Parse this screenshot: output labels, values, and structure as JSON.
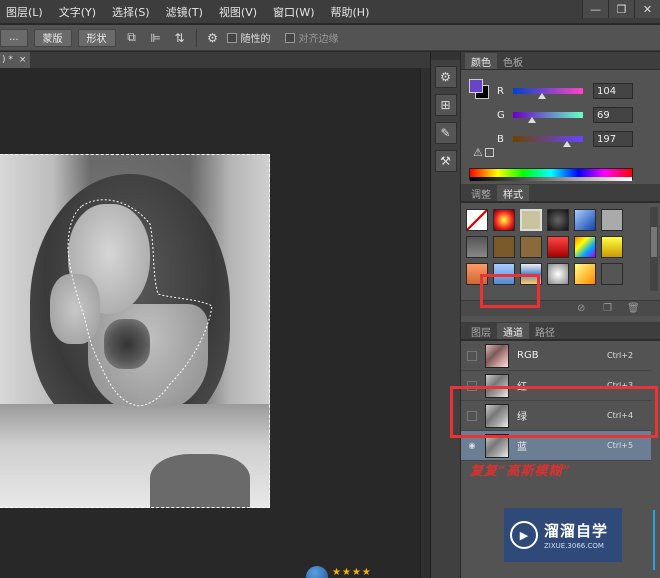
{
  "menu": [
    "图层(L)",
    "文字(Y)",
    "选择(S)",
    "滤镜(T)",
    "视图(V)",
    "窗口(W)",
    "帮助(H)"
  ],
  "window_controls": [
    "—",
    "❐",
    "✕"
  ],
  "options_bar": {
    "ellipsis": "...",
    "mask_label": "蒙版",
    "shape_label": "形状",
    "reset_checkbox_label": "随性的",
    "align_edges_label": "对齐边缘"
  },
  "doc_tab": {
    "label": ") *",
    "close": "×"
  },
  "color_panel": {
    "tabs": [
      "颜色",
      "色板"
    ],
    "r_label": "R",
    "g_label": "G",
    "b_label": "B",
    "r": "104",
    "g": "69",
    "b": "197",
    "fg_color": "#6845c5",
    "bg_color": "#000000"
  },
  "styles_panel": {
    "tabs": [
      "调整",
      "样式"
    ]
  },
  "channels_panel": {
    "tabs": [
      "图层",
      "通道",
      "路径"
    ],
    "channels": [
      {
        "name": "RGB",
        "shortcut": "Ctrl+2"
      },
      {
        "name": "红",
        "shortcut": "Ctrl+3"
      },
      {
        "name": "绿",
        "shortcut": "Ctrl+4"
      },
      {
        "name": "蓝",
        "shortcut": "Ctrl+5"
      }
    ]
  },
  "annotation": "复复“高斯模糊”",
  "watermark": {
    "title": "溜溜自学",
    "url": "ZIXUE.3066.COM"
  }
}
